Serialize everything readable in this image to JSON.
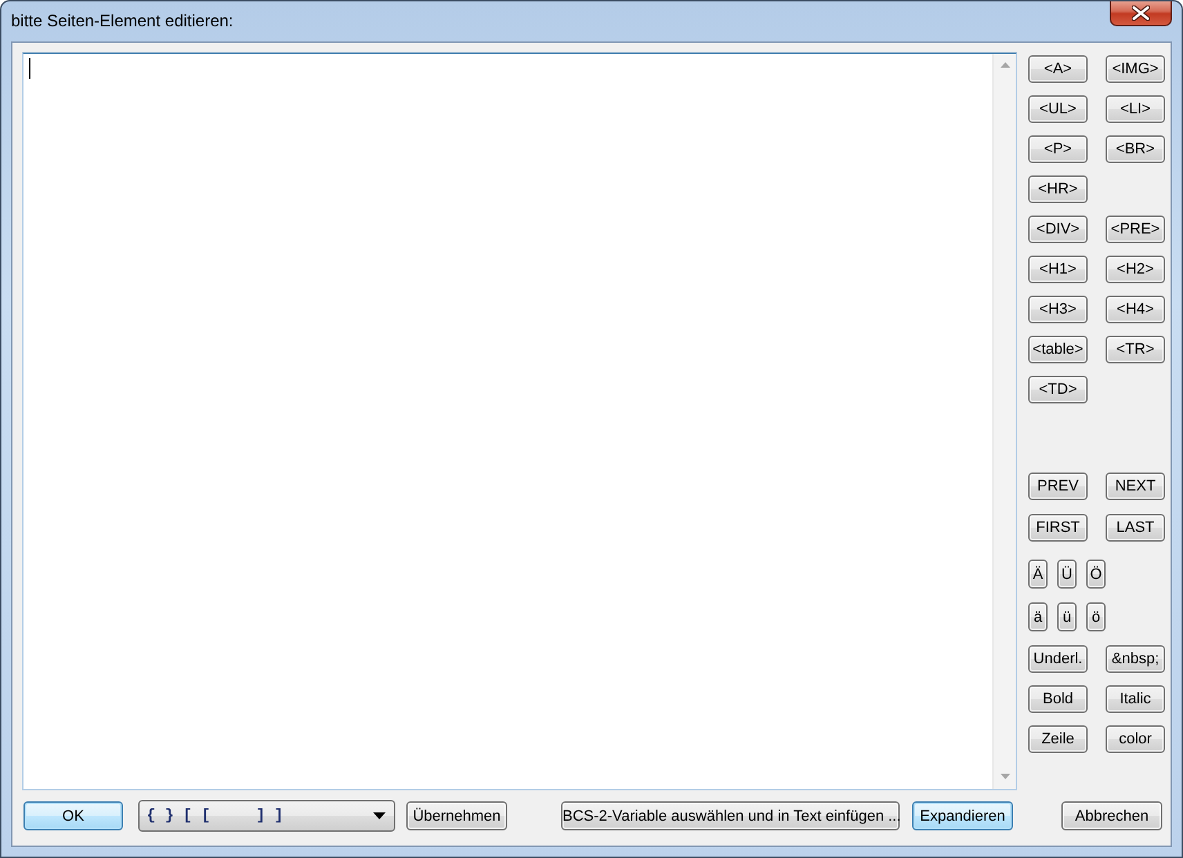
{
  "window": {
    "title": "bitte Seiten-Element editieren:"
  },
  "side_panel": {
    "sections": [
      {
        "kind": "tags",
        "rows": [
          [
            "<A>",
            "<IMG>"
          ],
          [
            "<UL>",
            "<LI>"
          ],
          [
            "<P>",
            "<BR>"
          ],
          [
            "<HR>"
          ],
          [
            "<DIV>",
            "<PRE>"
          ],
          [
            "<H1>",
            "<H2>"
          ],
          [
            "<H3>",
            "<H4>"
          ],
          [
            "<table>",
            "<TR>"
          ],
          [
            "<TD>"
          ]
        ]
      },
      {
        "kind": "nav",
        "rows": [
          [
            "PREV",
            "NEXT"
          ],
          [
            "FIRST",
            "LAST"
          ]
        ]
      },
      {
        "kind": "chars",
        "rows": [
          [
            "Ä",
            "Ü",
            "Ö"
          ],
          [
            "ä",
            "ü",
            "ö"
          ]
        ]
      },
      {
        "kind": "format",
        "rows": [
          [
            "Underl.",
            "&nbsp;"
          ],
          [
            "Bold",
            "Italic"
          ],
          [
            "Zeile",
            "color"
          ]
        ]
      }
    ]
  },
  "bottom_bar": [
    {
      "kind": "button",
      "label": "OK",
      "focused": true
    },
    {
      "kind": "dropdown",
      "value": "{ } [ [     ] ]"
    },
    {
      "kind": "button",
      "label": "Übernehmen",
      "focused": false
    },
    {
      "kind": "button",
      "label": "BCS-2-Variable auswählen und in Text einfügen ...",
      "focused": false
    },
    {
      "kind": "button",
      "label": "Expandieren",
      "focused": true
    },
    {
      "kind": "button",
      "label": "Abbrechen",
      "focused": false
    }
  ]
}
